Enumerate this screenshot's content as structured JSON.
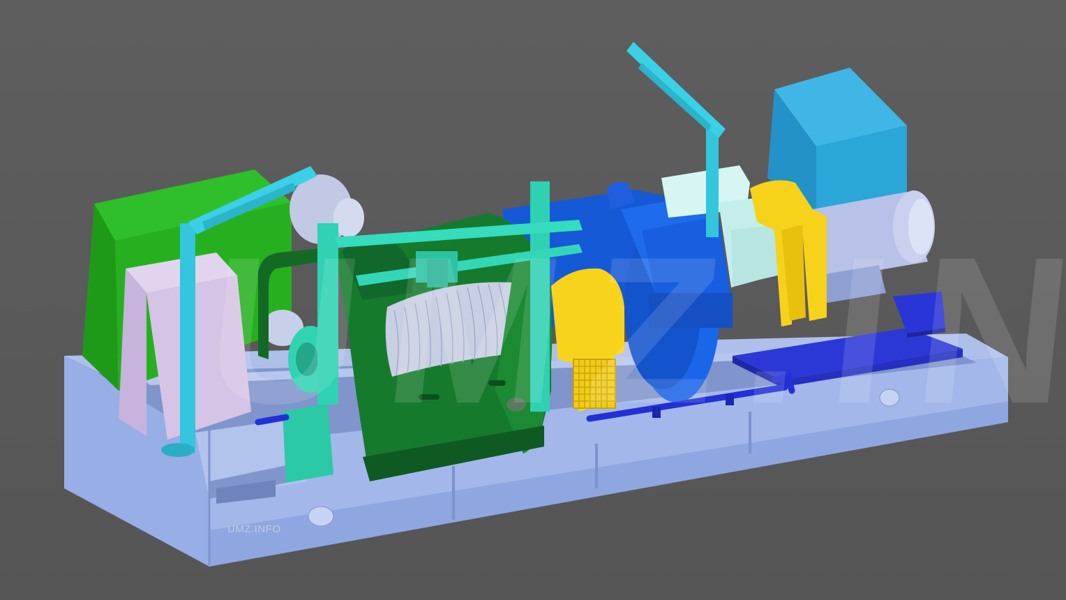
{
  "watermark": {
    "label": "UMZ.INFO",
    "background_text": "UMZ.INFO"
  },
  "colors": {
    "background": "#5b5b5b",
    "frame": "#9db2e6",
    "cabinet_green": "#22b01a",
    "drum_green": "#146f2a",
    "teal": "#2fd6b8",
    "cyan_arm": "#33c5dc",
    "gearbox_blue": "#1763e0",
    "guard_yellow": "#f6d21a",
    "motor_grey": "#b9c4e8",
    "cabinet_blue": "#2aa6d8",
    "pink_panel": "#d9c8e6",
    "light_aqua": "#c9f1ee",
    "tank_blue": "#2a35d8"
  },
  "icons": {
    "winch": "winch-drum",
    "motor": "electric-motor",
    "gearbox": "gearbox"
  }
}
